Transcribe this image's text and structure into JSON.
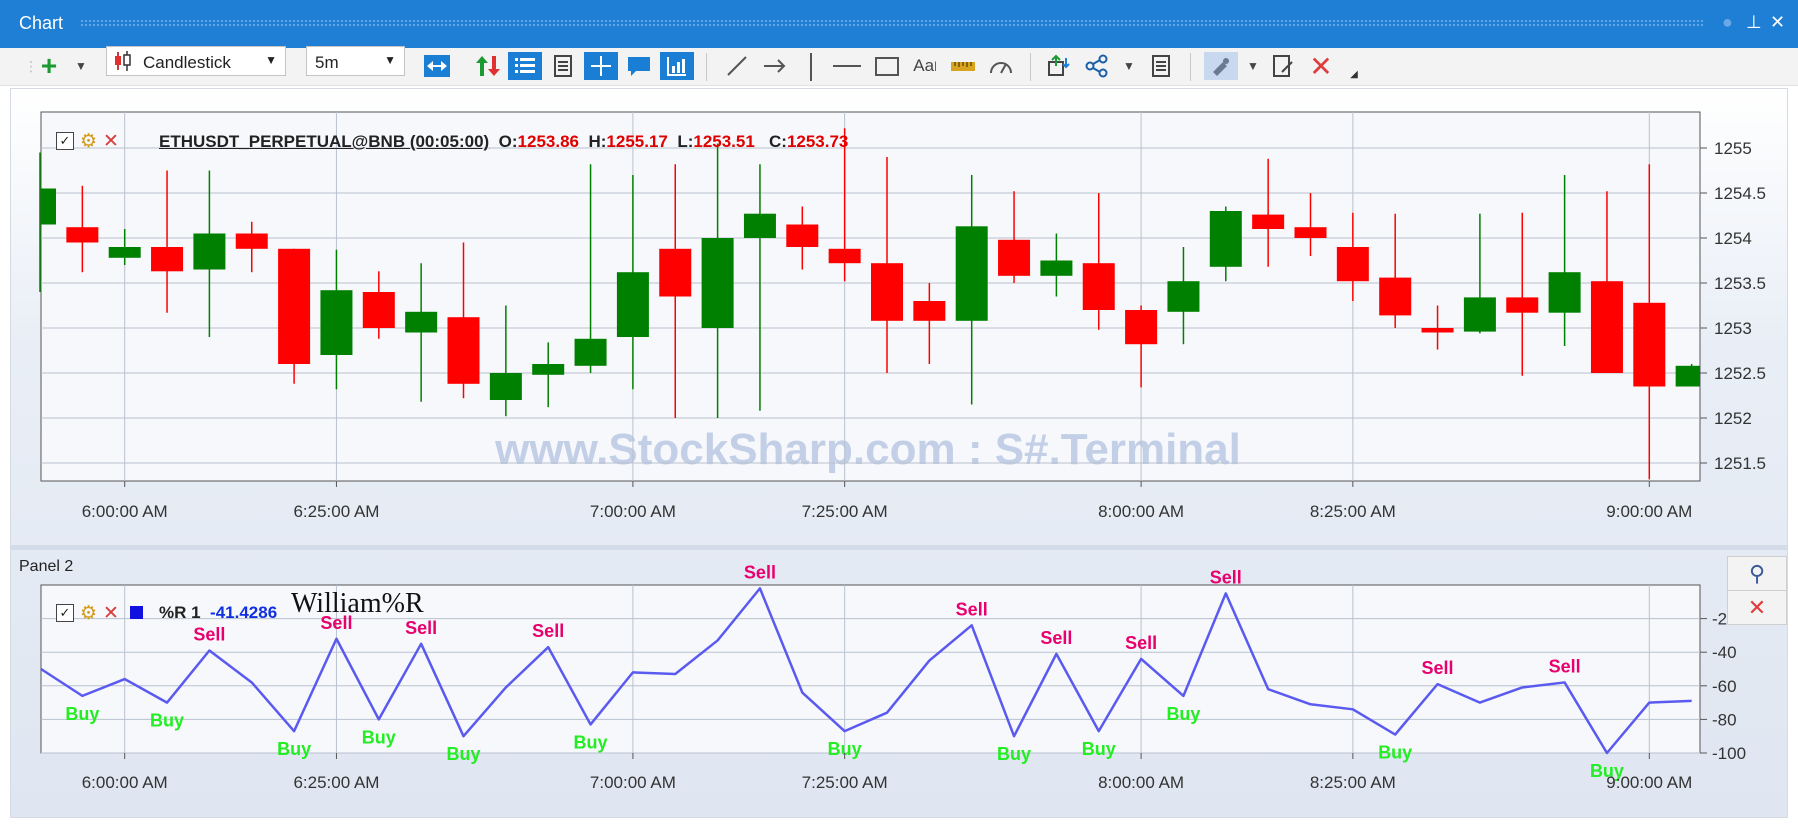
{
  "window": {
    "title": "Chart"
  },
  "toolbar": {
    "chart_type": "Candlestick",
    "timeframe": "5m"
  },
  "panel1": {
    "symbol": "ETHUSDT_PERPETUAL@BNB (00:05:00)",
    "open_label": "O:",
    "open": "1253.86",
    "high_label": "H:",
    "high": "1255.17",
    "low_label": "L:",
    "low": "1253.51",
    "close_label": "C:",
    "close": "1253.73",
    "watermark": "www.StockSharp.com  :  S#.Terminal"
  },
  "panel2": {
    "title": "Panel 2",
    "indicator": "%R 1",
    "indicator_value": "-41.4286",
    "annotation": "William%R"
  },
  "colors": {
    "up": "#008000",
    "down": "#ff0000",
    "wr_line": "#5a5af0",
    "buy": "#22ee22",
    "sell": "#e8006e"
  },
  "chart_data": [
    {
      "type": "candlestick",
      "x_ticks": [
        "6:00:00 AM",
        "6:25:00 AM",
        "7:00:00 AM",
        "7:25:00 AM",
        "8:00:00 AM",
        "8:25:00 AM",
        "9:00:00 AM"
      ],
      "x_tick_index": [
        2,
        7,
        14,
        19,
        26,
        31,
        38
      ],
      "ylim": [
        1251.3,
        1255.4
      ],
      "y_ticks": [
        1255,
        1254.5,
        1254,
        1253.5,
        1253,
        1252.5,
        1252,
        1251.5
      ],
      "candles": [
        {
          "o": 1254.15,
          "h": 1254.95,
          "l": 1253.4,
          "c": 1254.55
        },
        {
          "o": 1254.12,
          "h": 1254.58,
          "l": 1253.62,
          "c": 1253.95
        },
        {
          "o": 1253.78,
          "h": 1254.1,
          "l": 1253.7,
          "c": 1253.9
        },
        {
          "o": 1253.9,
          "h": 1254.75,
          "l": 1253.17,
          "c": 1253.63
        },
        {
          "o": 1253.65,
          "h": 1254.75,
          "l": 1252.9,
          "c": 1254.05
        },
        {
          "o": 1254.05,
          "h": 1254.18,
          "l": 1253.62,
          "c": 1253.88
        },
        {
          "o": 1253.88,
          "h": 1253.88,
          "l": 1252.38,
          "c": 1252.6
        },
        {
          "o": 1252.7,
          "h": 1253.87,
          "l": 1252.32,
          "c": 1253.42
        },
        {
          "o": 1253.4,
          "h": 1253.63,
          "l": 1252.88,
          "c": 1253.0
        },
        {
          "o": 1252.95,
          "h": 1253.72,
          "l": 1252.18,
          "c": 1253.18
        },
        {
          "o": 1253.12,
          "h": 1253.95,
          "l": 1252.22,
          "c": 1252.38
        },
        {
          "o": 1252.2,
          "h": 1253.25,
          "l": 1252.02,
          "c": 1252.5
        },
        {
          "o": 1252.48,
          "h": 1252.84,
          "l": 1252.12,
          "c": 1252.6
        },
        {
          "o": 1252.58,
          "h": 1254.82,
          "l": 1252.5,
          "c": 1252.88
        },
        {
          "o": 1252.9,
          "h": 1254.7,
          "l": 1252.32,
          "c": 1253.62
        },
        {
          "o": 1253.88,
          "h": 1254.82,
          "l": 1252.0,
          "c": 1253.35
        },
        {
          "o": 1253.0,
          "h": 1255.05,
          "l": 1252.0,
          "c": 1254.0
        },
        {
          "o": 1254.0,
          "h": 1254.82,
          "l": 1252.08,
          "c": 1254.27
        },
        {
          "o": 1254.15,
          "h": 1254.35,
          "l": 1253.65,
          "c": 1253.9
        },
        {
          "o": 1253.88,
          "h": 1255.22,
          "l": 1253.52,
          "c": 1253.72
        },
        {
          "o": 1253.72,
          "h": 1254.9,
          "l": 1252.5,
          "c": 1253.08
        },
        {
          "o": 1253.3,
          "h": 1253.5,
          "l": 1252.6,
          "c": 1253.08
        },
        {
          "o": 1253.08,
          "h": 1254.7,
          "l": 1252.15,
          "c": 1254.13
        },
        {
          "o": 1253.98,
          "h": 1254.52,
          "l": 1253.5,
          "c": 1253.58
        },
        {
          "o": 1253.58,
          "h": 1254.05,
          "l": 1253.35,
          "c": 1253.75
        },
        {
          "o": 1253.72,
          "h": 1254.5,
          "l": 1252.98,
          "c": 1253.2
        },
        {
          "o": 1253.2,
          "h": 1253.25,
          "l": 1252.34,
          "c": 1252.82
        },
        {
          "o": 1253.18,
          "h": 1253.9,
          "l": 1252.82,
          "c": 1253.52
        },
        {
          "o": 1253.68,
          "h": 1254.35,
          "l": 1253.52,
          "c": 1254.3
        },
        {
          "o": 1254.26,
          "h": 1254.88,
          "l": 1253.68,
          "c": 1254.1
        },
        {
          "o": 1254.12,
          "h": 1254.5,
          "l": 1253.8,
          "c": 1254.0
        },
        {
          "o": 1253.9,
          "h": 1254.28,
          "l": 1253.3,
          "c": 1253.52
        },
        {
          "o": 1253.56,
          "h": 1254.27,
          "l": 1253.0,
          "c": 1253.14
        },
        {
          "o": 1253.0,
          "h": 1253.25,
          "l": 1252.76,
          "c": 1252.95
        },
        {
          "o": 1252.96,
          "h": 1254.27,
          "l": 1252.94,
          "c": 1253.34
        },
        {
          "o": 1253.34,
          "h": 1254.28,
          "l": 1252.47,
          "c": 1253.17
        },
        {
          "o": 1253.17,
          "h": 1254.7,
          "l": 1252.8,
          "c": 1253.62
        },
        {
          "o": 1253.52,
          "h": 1254.52,
          "l": 1252.5,
          "c": 1252.5
        },
        {
          "o": 1253.28,
          "h": 1254.82,
          "l": 1251.32,
          "c": 1252.35
        },
        {
          "o": 1252.35,
          "h": 1252.6,
          "l": 1252.35,
          "c": 1252.58
        }
      ]
    },
    {
      "type": "line",
      "name": "%R 1",
      "ylim": [
        -100,
        0
      ],
      "y_ticks": [
        -20,
        -40,
        -60,
        -80,
        -100
      ],
      "x_ticks": [
        "6:00:00 AM",
        "6:25:00 AM",
        "7:00:00 AM",
        "7:25:00 AM",
        "8:00:00 AM",
        "8:25:00 AM",
        "9:00:00 AM"
      ],
      "x_tick_index": [
        2,
        7,
        14,
        19,
        26,
        31,
        38
      ],
      "values": [
        -50,
        -66,
        -56,
        -70,
        -39,
        -58,
        -87,
        -32,
        -80,
        -35,
        -90,
        -61,
        -37,
        -83,
        -52,
        -53,
        -33,
        -2,
        -64,
        -87,
        -76,
        -45,
        -24,
        -90,
        -41,
        -87,
        -44,
        -66,
        -5,
        -62,
        -71,
        -74,
        -89,
        -59,
        -70,
        -61,
        -58,
        -100,
        -70,
        -69
      ],
      "signals": [
        {
          "i": 1,
          "type": "Buy"
        },
        {
          "i": 3,
          "type": "Buy"
        },
        {
          "i": 4,
          "type": "Sell"
        },
        {
          "i": 6,
          "type": "Buy"
        },
        {
          "i": 7,
          "type": "Sell"
        },
        {
          "i": 8,
          "type": "Buy"
        },
        {
          "i": 9,
          "type": "Sell"
        },
        {
          "i": 10,
          "type": "Buy"
        },
        {
          "i": 12,
          "type": "Sell"
        },
        {
          "i": 13,
          "type": "Buy"
        },
        {
          "i": 17,
          "type": "Sell"
        },
        {
          "i": 19,
          "type": "Buy"
        },
        {
          "i": 22,
          "type": "Sell"
        },
        {
          "i": 23,
          "type": "Buy"
        },
        {
          "i": 24,
          "type": "Sell"
        },
        {
          "i": 25,
          "type": "Buy"
        },
        {
          "i": 26,
          "type": "Sell"
        },
        {
          "i": 27,
          "type": "Buy"
        },
        {
          "i": 28,
          "type": "Sell"
        },
        {
          "i": 32,
          "type": "Buy"
        },
        {
          "i": 33,
          "type": "Sell"
        },
        {
          "i": 36,
          "type": "Sell"
        },
        {
          "i": 37,
          "type": "Buy"
        }
      ]
    }
  ]
}
